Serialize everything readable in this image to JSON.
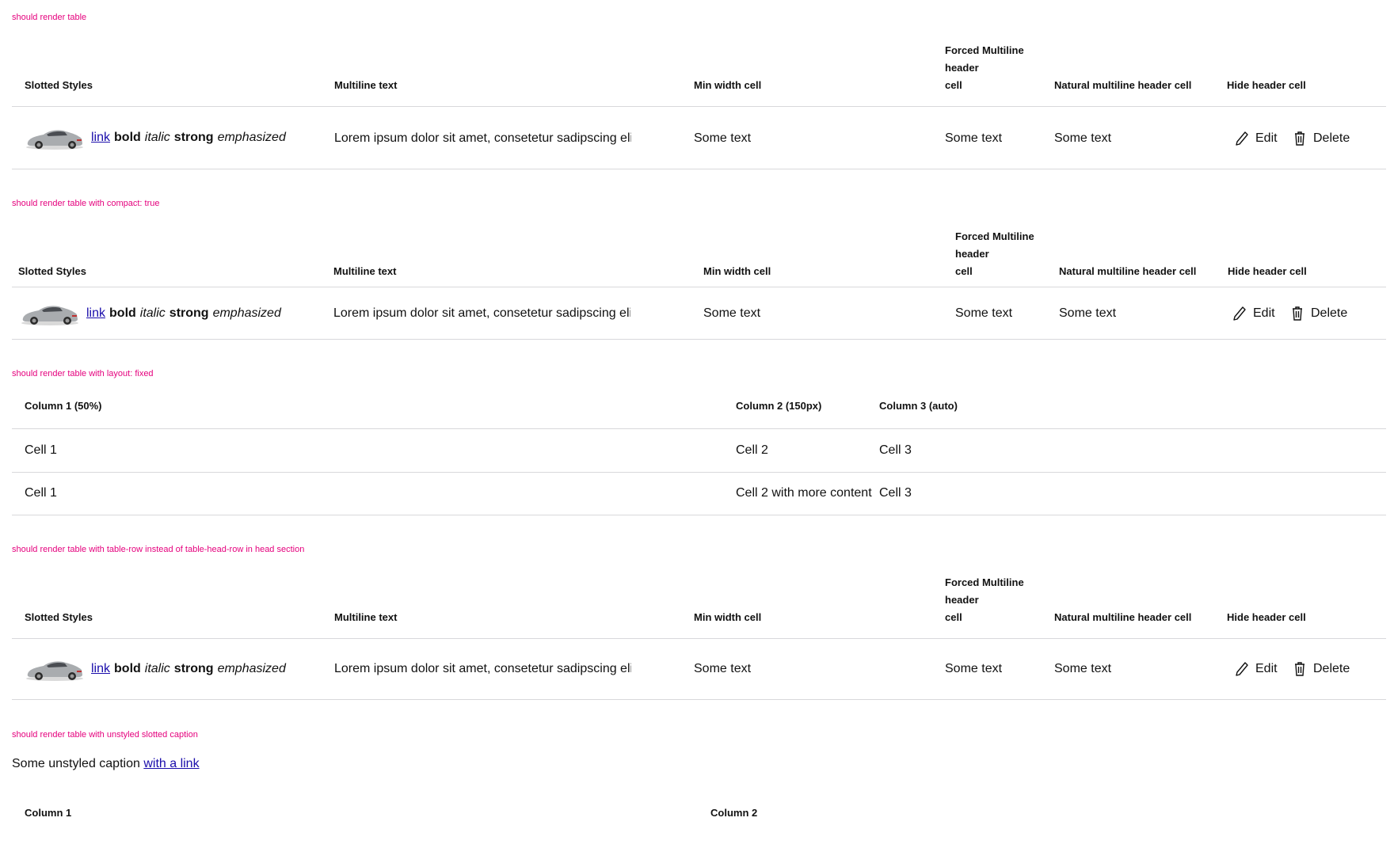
{
  "colors": {
    "label": "#e5007d",
    "link": "#1a0dab",
    "divider": "#d8d8db"
  },
  "sections": {
    "s1": {
      "label": "should render table"
    },
    "s2": {
      "label": "should render table with compact: true"
    },
    "s3": {
      "label": "should render table with layout: fixed"
    },
    "s4": {
      "label": "should render table with table-row instead of table-head-row in head section"
    },
    "s5": {
      "label": "should render table with unstyled slotted caption"
    }
  },
  "table_main": {
    "headers": {
      "slotted": "Slotted Styles",
      "multiline": "Multiline text",
      "min_width": "Min width cell",
      "forced": [
        "Forced Multiline",
        "header",
        "cell"
      ],
      "natural": "Natural multiline header cell",
      "hide": "Hide header cell"
    },
    "row": {
      "car_icon": "car-icon",
      "link": "link",
      "bold": "bold",
      "italic": "italic",
      "strong": "strong",
      "emphasized": "emphasized",
      "multiline": "Lorem ipsum dolor sit amet, consetetur sadipscing elitr",
      "min_width": "Some text",
      "forced": "Some text",
      "natural": "Some text",
      "edit_label": "Edit",
      "edit_icon": "pencil-icon",
      "delete_label": "Delete",
      "delete_icon": "trash-icon"
    }
  },
  "table_fixed": {
    "headers": [
      "Column 1 (50%)",
      "Column 2 (150px)",
      "Column 3 (auto)"
    ],
    "rows": [
      [
        "Cell 1",
        "Cell 2",
        "Cell 3"
      ],
      [
        "Cell 1",
        "Cell 2 with more content",
        "Cell 3"
      ]
    ]
  },
  "table_caption": {
    "caption_text": "Some unstyled caption",
    "caption_link": "with a link",
    "headers": [
      "Column 1",
      "Column 2"
    ]
  }
}
